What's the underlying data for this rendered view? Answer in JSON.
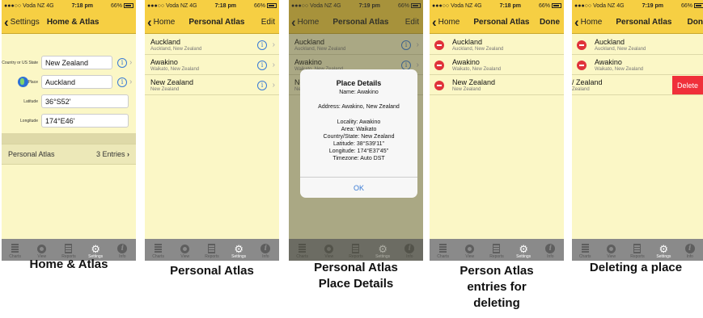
{
  "statusbar": {
    "carrier": "●●●○○ Voda NZ  4G",
    "battery": "66%",
    "times": [
      "7:18 pm",
      "7:18 pm",
      "7:19 pm",
      "7:18 pm",
      "7:19 pm"
    ]
  },
  "tabs": {
    "charts": "Charts",
    "view": "View",
    "reports": "Reports",
    "settings": "Settings",
    "info": "Info"
  },
  "screen1": {
    "back": "Settings",
    "title": "Home & Atlas",
    "country_label": "Country or US State",
    "country_value": "New Zealand",
    "place_label": "Place",
    "place_value": "Auckland",
    "latitude_label": "Latitude",
    "latitude_value": "36°S52'",
    "longitude_label": "Longitude",
    "longitude_value": "174°E46'",
    "atlas_label": "Personal Atlas",
    "atlas_entries": "3 Entries"
  },
  "screen2": {
    "back": "Home",
    "title": "Personal Atlas",
    "edit": "Edit"
  },
  "places": [
    {
      "name": "Auckland",
      "region": "Auckland, New Zealand"
    },
    {
      "name": "Awakino",
      "region": "Waikato, New Zealand"
    },
    {
      "name": "New Zealand",
      "region": "New Zealand"
    }
  ],
  "screen3": {
    "back": "Home",
    "title": "Personal Atlas",
    "edit": "Edit",
    "alert": {
      "title": "Place Details",
      "name": "Name: Awakino",
      "address": "Address: Awakino, New Zealand",
      "locality": "Locality: Awakino",
      "area": "Area: Waikato",
      "country": "Country/State: New Zealand",
      "latitude": "Latitude: 38°S39'11\"",
      "longitude": "Longitude: 174°E37'45\"",
      "timezone": "Timezone: Auto DST",
      "ok": "OK"
    }
  },
  "screen4": {
    "back": "Home",
    "title": "Personal Atlas",
    "done": "Done"
  },
  "screen5": {
    "back": "Home",
    "title": "Personal Atlas",
    "done": "Don",
    "row3_name": "/ Zealand",
    "row3_sub": "Zealand",
    "delete": "Delete"
  },
  "captions": {
    "c1": "Home & Atlas",
    "c2": "Personal Atlas",
    "c3a": "Personal Atlas",
    "c3b": "Place Details",
    "c4a": "Person Atlas",
    "c4b": "entries for",
    "c4c": "deleting",
    "c5": "Deleting a place"
  }
}
